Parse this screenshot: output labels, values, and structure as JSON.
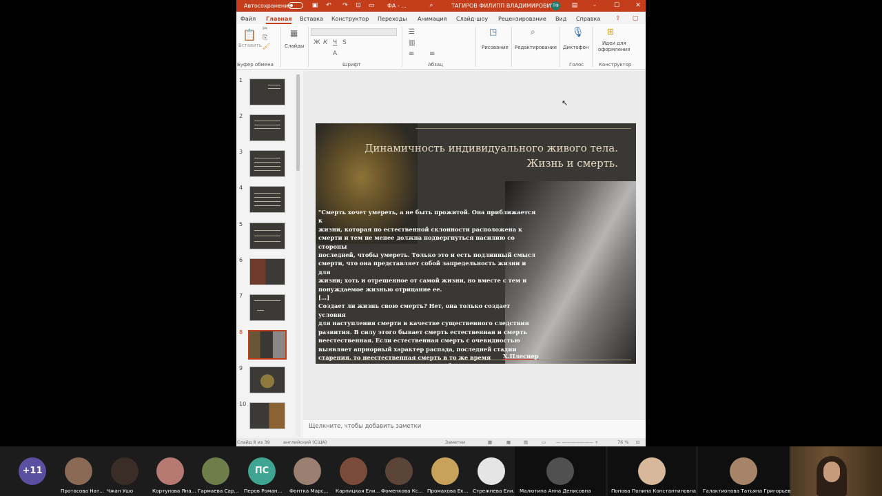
{
  "titlebar": {
    "autosave": "Автосохранение",
    "doc": "ФА - ...",
    "user": "ТАГИРОВ ФИЛИПП ВЛАДИМИРОВИЧ",
    "initials": "ТФ"
  },
  "tabs": [
    "Файл",
    "Главная",
    "Вставка",
    "Конструктор",
    "Переходы",
    "Анимация",
    "Слайд-шоу",
    "Рецензирование",
    "Вид",
    "Справка"
  ],
  "ribbon": {
    "paste": "Вставить",
    "slides": "Слайды",
    "clipboard": "Буфер обмена",
    "font": "Шрифт",
    "paragraph": "Абзац",
    "drawing": "Рисование",
    "editing": "Редактирование",
    "dictaphone": "Диктофон",
    "voice": "Голос",
    "ideas1": "Идеи для",
    "ideas2": "оформления",
    "designer": "Конструктор"
  },
  "thumbnails": [
    "1",
    "2",
    "3",
    "4",
    "5",
    "6",
    "7",
    "8",
    "9",
    "10"
  ],
  "slide": {
    "title_line1": "Динамичность индивидуального живого тела.",
    "title_line2": "Жизнь и смерть.",
    "quote": "\"Смерть хочет умереть, а не быть прожитой. Она приближается к\nжизни, которая по естественной склонности расположена к\nсмерти и тем не менее должна подвергнуться насилию со стороны\nпоследней, чтобы умереть. Только это и есть подлинный смысл\nсмерти, что она представляет собой запредельность жизни и для\nжизни; хоть и отрешенное от самой жизни, но вместе с тем и\nпонуждаемое жизнью отрицание ее.\n[…]\nСоздает ли жизнь свою смерть? Нет, она только создает условия\nдля наступления смерти в качестве существенного следствия\nразвития. В силу этого бывает смерть естественная и смерть\nнеестественная. Если естественная смерть с очевидностью\nвыявляет априорный характер распада, последней стадии\nстарения, то неестественная смерть в то же время\nсвидетельствует о наличии отделенной от жизни, по сути\nбытийно отделенной от нее, силы, из которой берет свое начало\nразрушение\".",
    "author": "Х.Плеснер"
  },
  "notes_placeholder": "Щелкните, чтобы добавить заметки",
  "status": {
    "slide": "Слайд 8 из 39",
    "lang": "английский (США)",
    "notes": "Заметки",
    "zoom": "76 %"
  },
  "participants": [
    {
      "name": "+11",
      "color": "#5a4fa0"
    },
    {
      "name": "Протасова Нат...",
      "color": "#8a6a55"
    },
    {
      "name": "Чжан Ушо",
      "color": "#3a2d28"
    },
    {
      "name": "Кортунова Яна...",
      "color": "#b77a72"
    },
    {
      "name": "Гармаева Сар...",
      "color": "#6f7d4b"
    },
    {
      "name": "Перов Роман...",
      "initials": "ПС",
      "color": "#3fa592"
    },
    {
      "name": "Фонтка Марс...",
      "color": "#9b7f70"
    },
    {
      "name": "Карпицкая Ели...",
      "color": "#7a4a3a"
    },
    {
      "name": "Фоменкова Кс...",
      "color": "#5b4438"
    },
    {
      "name": "Промахова Ек...",
      "color": "#c7a25a"
    },
    {
      "name": "Стрежнева Ели...",
      "color": "#e5e5e5"
    }
  ],
  "participants_wide": [
    {
      "name": "Малютина Анна Денисовна",
      "color": "#505050"
    },
    {
      "name": "Попова Полина Константиновна",
      "color": "#d8b89a"
    },
    {
      "name": "Галактионова Татьяна Григорьевна",
      "color": "#a58468"
    }
  ]
}
